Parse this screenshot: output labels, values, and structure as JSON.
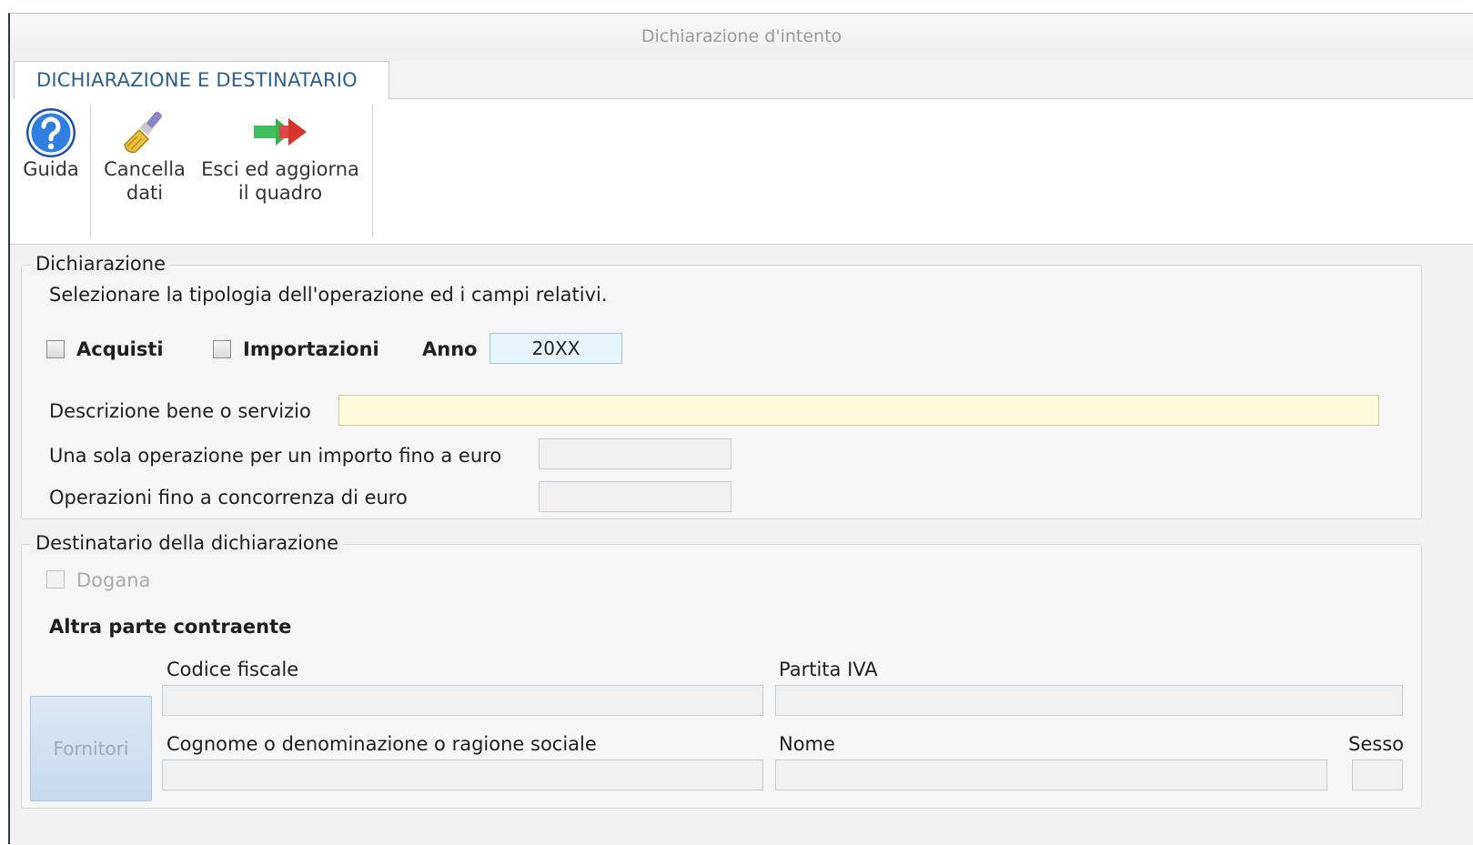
{
  "window": {
    "title": "Dichiarazione d'intento"
  },
  "tabs": [
    {
      "label": "DICHIARAZIONE E DESTINATARIO"
    }
  ],
  "ribbon": {
    "guida": {
      "line1": "Guida",
      "icon": "help-icon"
    },
    "cancella": {
      "line1": "Cancella",
      "line2": "dati",
      "icon": "brush-icon"
    },
    "esci": {
      "line1": "Esci ed aggiorna",
      "line2": "il quadro",
      "icon": "arrow-right-icon"
    }
  },
  "dichiarazione": {
    "legend": "Dichiarazione",
    "instructions": "Selezionare la tipologia dell'operazione ed i campi relativi.",
    "acquisti_label": "Acquisti",
    "importazioni_label": "Importazioni",
    "anno_label": "Anno",
    "anno_value": "20XX",
    "descrizione_label": "Descrizione bene o servizio",
    "descrizione_value": "",
    "una_sola_label": "Una sola operazione per un importo fino a euro",
    "una_sola_value": "",
    "concorrenza_label": "Operazioni fino a concorrenza di euro",
    "concorrenza_value": ""
  },
  "destinatario": {
    "legend": "Destinatario della dichiarazione",
    "dogana_label": "Dogana",
    "altra_parte_label": "Altra parte contraente",
    "fornitori_button": "Fornitori",
    "codice_fiscale_label": "Codice fiscale",
    "codice_fiscale_value": "",
    "partita_iva_label": "Partita IVA",
    "partita_iva_value": "",
    "cognome_label": "Cognome o denominazione o ragione sociale",
    "cognome_value": "",
    "nome_label": "Nome",
    "nome_value": "",
    "sesso_label": "Sesso",
    "sesso_value": ""
  },
  "colors": {
    "tab_text": "#2b5f8c",
    "anno_bg": "#e6f4fb",
    "descrizione_bg": "#fdf9db"
  }
}
